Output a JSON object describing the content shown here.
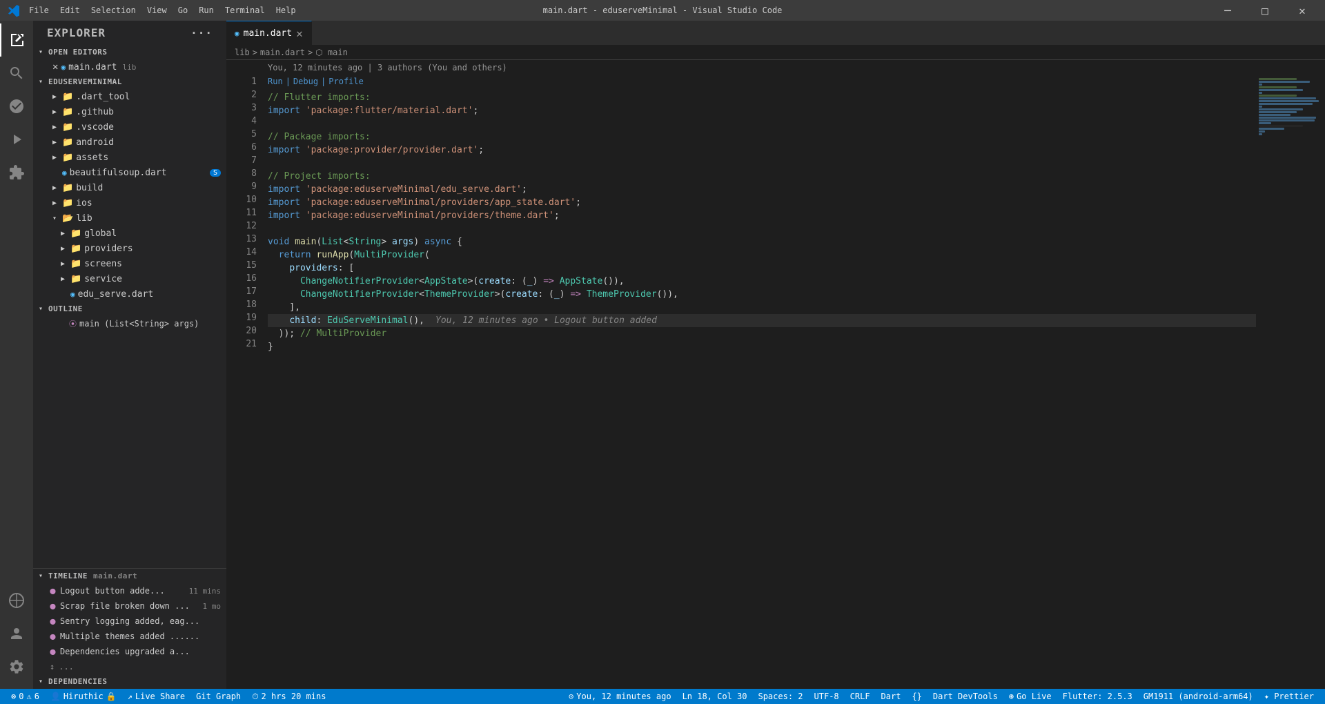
{
  "window": {
    "title": "main.dart - eduserveMinimal - Visual Studio Code",
    "controls": {
      "minimize": "─",
      "maximize": "□",
      "close": "✕"
    }
  },
  "menu": {
    "items": [
      "File",
      "Edit",
      "Selection",
      "View",
      "Go",
      "Run",
      "Terminal",
      "Help"
    ]
  },
  "activitybar": {
    "icons": [
      {
        "name": "explorer-icon",
        "symbol": "⎘",
        "active": true
      },
      {
        "name": "search-icon",
        "symbol": "🔍"
      },
      {
        "name": "source-control-icon",
        "symbol": "⑂"
      },
      {
        "name": "run-icon",
        "symbol": "▷"
      },
      {
        "name": "extensions-icon",
        "symbol": "⊞"
      },
      {
        "name": "remote-icon",
        "symbol": "○"
      },
      {
        "name": "account-icon",
        "symbol": "👤"
      },
      {
        "name": "settings-icon",
        "symbol": "⚙"
      }
    ]
  },
  "sidebar": {
    "header": "EXPLORER",
    "sections": {
      "open_editors": {
        "label": "OPEN EDITORS",
        "files": [
          {
            "name": "main.dart",
            "tag": "lib",
            "modified": true
          }
        ]
      },
      "project": {
        "label": "EDUSERVEMINIMAL",
        "items": [
          {
            "name": ".dart_tool",
            "type": "folder",
            "indent": 1
          },
          {
            "name": ".github",
            "type": "folder",
            "indent": 1
          },
          {
            "name": ".vscode",
            "type": "folder",
            "indent": 1
          },
          {
            "name": "android",
            "type": "folder",
            "indent": 1
          },
          {
            "name": "assets",
            "type": "folder",
            "indent": 1
          },
          {
            "name": "beautifulsoup.dart",
            "type": "file",
            "indent": 1,
            "badge": "S"
          },
          {
            "name": "build",
            "type": "folder",
            "indent": 1
          },
          {
            "name": "ios",
            "type": "folder",
            "indent": 1
          },
          {
            "name": "lib",
            "type": "folder",
            "indent": 1,
            "open": true
          },
          {
            "name": "global",
            "type": "folder",
            "indent": 2
          },
          {
            "name": "providers",
            "type": "folder",
            "indent": 2
          },
          {
            "name": "screens",
            "type": "folder",
            "indent": 2
          },
          {
            "name": "service",
            "type": "folder",
            "indent": 2
          },
          {
            "name": "edu_serve.dart",
            "type": "file",
            "indent": 2
          }
        ]
      },
      "outline": {
        "label": "OUTLINE",
        "items": [
          {
            "name": "main (List<String> args)",
            "symbol": "⦿"
          }
        ]
      },
      "timeline": {
        "label": "TIMELINE",
        "file": "main.dart",
        "items": [
          {
            "text": "Logout button adde...",
            "time": "11 mins"
          },
          {
            "text": "Scrap file broken down ...",
            "time": "1 mo"
          },
          {
            "text": "Sentry logging added, eag...",
            "time": ""
          },
          {
            "text": "Multiple themes added ......",
            "time": ""
          },
          {
            "text": "Dependencies upgraded a...",
            "time": ""
          },
          {
            "text": "↕ ...",
            "time": ""
          }
        ]
      },
      "dependencies": {
        "label": "DEPENDENCIES"
      }
    }
  },
  "editor": {
    "tab": {
      "filename": "main.dart",
      "modified": false
    },
    "breadcrumb": [
      "lib",
      ">",
      "main.dart",
      ">",
      "⬡ main"
    ],
    "git_info": "You, 12 minutes ago | 3 authors (You and others)",
    "run_debug": [
      "Run",
      "|",
      "Debug",
      "|",
      "Profile"
    ],
    "lines": [
      {
        "num": 1,
        "content": [
          {
            "cls": "cm",
            "t": "// Flutter imports:"
          }
        ]
      },
      {
        "num": 2,
        "content": [
          {
            "cls": "kw",
            "t": "import"
          },
          {
            "cls": "plain",
            "t": " "
          },
          {
            "cls": "str",
            "t": "'package:flutter/material.dart'"
          },
          {
            "cls": "plain",
            "t": ";"
          }
        ]
      },
      {
        "num": 3,
        "content": []
      },
      {
        "num": 4,
        "content": [
          {
            "cls": "cm",
            "t": "// Package imports:"
          }
        ]
      },
      {
        "num": 5,
        "content": [
          {
            "cls": "kw",
            "t": "import"
          },
          {
            "cls": "plain",
            "t": " "
          },
          {
            "cls": "str",
            "t": "'package:provider/provider.dart'"
          },
          {
            "cls": "plain",
            "t": ";"
          }
        ]
      },
      {
        "num": 6,
        "content": []
      },
      {
        "num": 7,
        "content": [
          {
            "cls": "cm",
            "t": "// Project imports:"
          }
        ]
      },
      {
        "num": 8,
        "content": [
          {
            "cls": "kw",
            "t": "import"
          },
          {
            "cls": "plain",
            "t": " "
          },
          {
            "cls": "str",
            "t": "'package:eduserveMinimal/edu_serve.dart'"
          },
          {
            "cls": "plain",
            "t": ";"
          }
        ]
      },
      {
        "num": 9,
        "content": [
          {
            "cls": "kw",
            "t": "import"
          },
          {
            "cls": "plain",
            "t": " "
          },
          {
            "cls": "str",
            "t": "'package:eduserveMinimal/providers/app_state.dart'"
          },
          {
            "cls": "plain",
            "t": ";"
          }
        ]
      },
      {
        "num": 10,
        "content": [
          {
            "cls": "kw",
            "t": "import"
          },
          {
            "cls": "plain",
            "t": " "
          },
          {
            "cls": "str",
            "t": "'package:eduserveMinimal/providers/theme.dart'"
          },
          {
            "cls": "plain",
            "t": ";"
          }
        ]
      },
      {
        "num": 11,
        "content": []
      },
      {
        "num": 12,
        "content": [
          {
            "cls": "kw",
            "t": "void"
          },
          {
            "cls": "plain",
            "t": " "
          },
          {
            "cls": "fn",
            "t": "main"
          },
          {
            "cls": "plain",
            "t": "("
          },
          {
            "cls": "type",
            "t": "List"
          },
          {
            "cls": "plain",
            "t": "<"
          },
          {
            "cls": "type",
            "t": "String"
          },
          {
            "cls": "plain",
            "t": "> "
          },
          {
            "cls": "param",
            "t": "args"
          },
          {
            "cls": "plain",
            "t": ") "
          },
          {
            "cls": "kw",
            "t": "async"
          },
          {
            "cls": "plain",
            "t": " {"
          }
        ]
      },
      {
        "num": 13,
        "content": [
          {
            "cls": "plain",
            "t": "  "
          },
          {
            "cls": "kw",
            "t": "return"
          },
          {
            "cls": "plain",
            "t": " "
          },
          {
            "cls": "fn",
            "t": "runApp"
          },
          {
            "cls": "plain",
            "t": "("
          },
          {
            "cls": "type",
            "t": "MultiProvider"
          },
          {
            "cls": "plain",
            "t": "("
          }
        ]
      },
      {
        "num": 14,
        "content": [
          {
            "cls": "plain",
            "t": "    "
          },
          {
            "cls": "param",
            "t": "providers"
          },
          {
            "cls": "plain",
            "t": ": ["
          }
        ]
      },
      {
        "num": 15,
        "content": [
          {
            "cls": "plain",
            "t": "      "
          },
          {
            "cls": "type",
            "t": "ChangeNotifierProvider"
          },
          {
            "cls": "plain",
            "t": "<"
          },
          {
            "cls": "type",
            "t": "AppState"
          },
          {
            "cls": "plain",
            "t": ">("
          },
          {
            "cls": "param",
            "t": "create"
          },
          {
            "cls": "plain",
            "t": ": ("
          },
          {
            "cls": "param",
            "t": "_"
          },
          {
            "cls": "plain",
            "t": ") "
          },
          {
            "cls": "lambda",
            "t": "=>"
          },
          {
            "cls": "plain",
            "t": " "
          },
          {
            "cls": "type",
            "t": "AppState"
          },
          {
            "cls": "plain",
            "t": "()),"
          }
        ]
      },
      {
        "num": 16,
        "content": [
          {
            "cls": "plain",
            "t": "      "
          },
          {
            "cls": "type",
            "t": "ChangeNotifierProvider"
          },
          {
            "cls": "plain",
            "t": "<"
          },
          {
            "cls": "type",
            "t": "ThemeProvider"
          },
          {
            "cls": "plain",
            "t": ">("
          },
          {
            "cls": "param",
            "t": "create"
          },
          {
            "cls": "plain",
            "t": ": ("
          },
          {
            "cls": "param",
            "t": "_"
          },
          {
            "cls": "plain",
            "t": ") "
          },
          {
            "cls": "lambda",
            "t": "=>"
          },
          {
            "cls": "plain",
            "t": " "
          },
          {
            "cls": "type",
            "t": "ThemeProvider"
          },
          {
            "cls": "plain",
            "t": "()),"
          }
        ]
      },
      {
        "num": 17,
        "content": [
          {
            "cls": "plain",
            "t": "    ],"
          }
        ]
      },
      {
        "num": 18,
        "content": [
          {
            "cls": "plain",
            "t": "    "
          },
          {
            "cls": "param",
            "t": "child"
          },
          {
            "cls": "plain",
            "t": ": "
          },
          {
            "cls": "type",
            "t": "EduServeMinimal"
          },
          {
            "cls": "plain",
            "t": "(),"
          },
          {
            "cls": "git_blame",
            "t": "You, 12 minutes ago • Logout button added"
          }
        ],
        "highlight": true,
        "warning": true
      },
      {
        "num": 19,
        "content": [
          {
            "cls": "plain",
            "t": "  )); "
          },
          {
            "cls": "cm",
            "t": "// MultiProvider"
          }
        ]
      },
      {
        "num": 20,
        "content": [
          {
            "cls": "plain",
            "t": "}"
          }
        ]
      },
      {
        "num": 21,
        "content": []
      }
    ]
  },
  "statusbar": {
    "left_items": [
      {
        "icon": "⚠",
        "text": "0",
        "extra": "⊗ 0  ⚠ 6"
      },
      {
        "icon": "",
        "text": "Hiruthic 🔒"
      }
    ],
    "live_share": "Live Share",
    "git_graph": "Git Graph",
    "time": "2 hrs 20 mins",
    "right_items": [
      {
        "text": "⊙ You, 12 minutes ago"
      },
      {
        "text": "Ln 18, Col 30"
      },
      {
        "text": "Spaces: 2"
      },
      {
        "text": "UTF-8"
      },
      {
        "text": "CRLF"
      },
      {
        "text": "Dart"
      },
      {
        "text": "{}"
      },
      {
        "text": "Dart DevTools"
      },
      {
        "text": "⊛ Go Live"
      },
      {
        "text": "Flutter: 2.5.3"
      },
      {
        "text": "GM1911 (android-arm64)"
      },
      {
        "text": "✦ Prettier"
      }
    ]
  }
}
